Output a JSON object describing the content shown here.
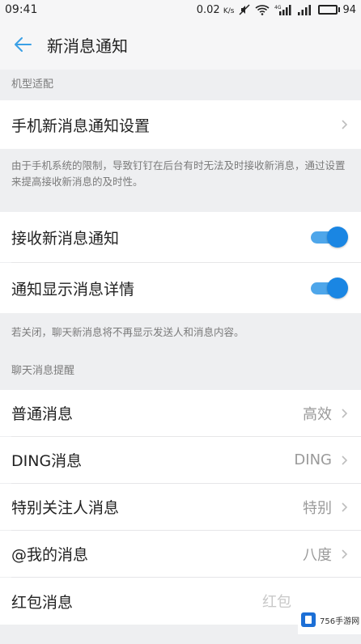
{
  "status": {
    "time": "09:41",
    "speed": "0.02",
    "speed_unit": "K/s",
    "battery": "94"
  },
  "header": {
    "title": "新消息通知"
  },
  "sections": {
    "device": {
      "title": "机型适配",
      "row_label": "手机新消息通知设置",
      "note": "由于手机系统的限制，导致钉钉在后台有时无法及时接收新消息，通过设置来提高接收新消息的及时性。"
    },
    "receive": {
      "toggle1_label": "接收新消息通知",
      "toggle1_on": true,
      "toggle2_label": "通知显示消息详情",
      "toggle2_on": true,
      "note": "若关闭，聊天新消息将不再显示发送人和消息内容。"
    },
    "alerts": {
      "title": "聊天消息提醒",
      "items": [
        {
          "label": "普通消息",
          "value": "高效"
        },
        {
          "label": "DING消息",
          "value": "DING"
        },
        {
          "label": "特别关注人消息",
          "value": "特别"
        },
        {
          "label": "@我的消息",
          "value": "八度"
        },
        {
          "label": "红包消息",
          "value": "红包"
        }
      ]
    }
  },
  "watermark": {
    "text": "756手游网"
  },
  "colors": {
    "accent": "#1a86e3",
    "toggle_track": "#4ea6ea",
    "back_arrow": "#3aa0e6"
  }
}
